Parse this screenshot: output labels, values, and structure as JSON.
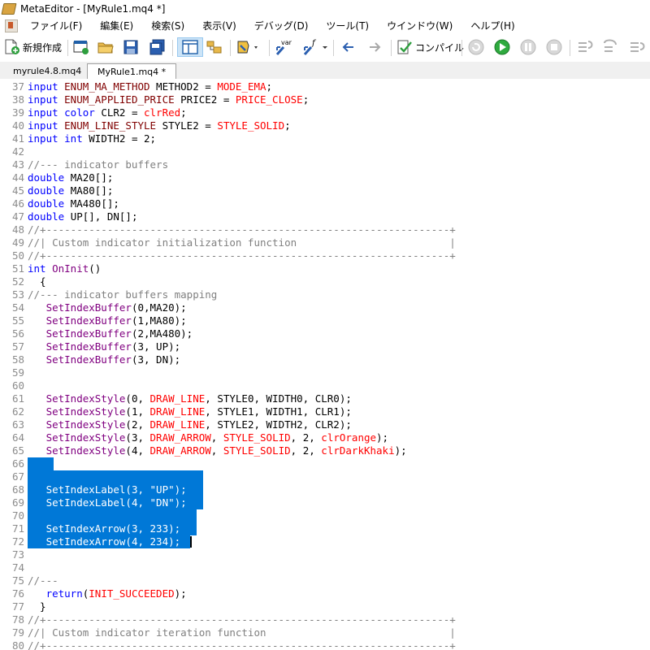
{
  "window": {
    "title": "MetaEditor - [MyRule1.mq4 *]"
  },
  "menu": [
    "ファイル(F)",
    "編集(E)",
    "検索(S)",
    "表示(V)",
    "デバッグ(D)",
    "ツール(T)",
    "ウインドウ(W)",
    "ヘルプ(H)"
  ],
  "toolbar": {
    "new_label": "新規作成",
    "compile_label": "コンパイル",
    "var_label": "var",
    "f_label": "f"
  },
  "tabs": [
    {
      "label": "myrule4.8.mq4",
      "active": false
    },
    {
      "label": "MyRule1.mq4 *",
      "active": true
    }
  ],
  "colors": {
    "selection": "#0078d7",
    "keyword": "#0000ff",
    "constant": "#ff0000",
    "function": "#800080",
    "comment": "#808080"
  },
  "selection": {
    "from_line": 66,
    "to_line": 72
  },
  "lines": [
    {
      "n": "37",
      "tokens": [
        [
          "kw",
          "input "
        ],
        [
          "ty",
          "ENUM_MA_METHOD"
        ],
        [
          "id",
          " METHOD2 = "
        ],
        [
          "cn",
          "MODE_EMA"
        ],
        [
          "id",
          ";"
        ]
      ]
    },
    {
      "n": "38",
      "tokens": [
        [
          "kw",
          "input "
        ],
        [
          "ty",
          "ENUM_APPLIED_PRICE"
        ],
        [
          "id",
          " PRICE2 = "
        ],
        [
          "cn",
          "PRICE_CLOSE"
        ],
        [
          "id",
          ";"
        ]
      ]
    },
    {
      "n": "39",
      "tokens": [
        [
          "kw",
          "input color "
        ],
        [
          "id",
          "CLR2 = "
        ],
        [
          "cn",
          "clrRed"
        ],
        [
          "id",
          ";"
        ]
      ]
    },
    {
      "n": "40",
      "tokens": [
        [
          "kw",
          "input "
        ],
        [
          "ty",
          "ENUM_LINE_STYLE"
        ],
        [
          "id",
          " STYLE2 = "
        ],
        [
          "cn",
          "STYLE_SOLID"
        ],
        [
          "id",
          ";"
        ]
      ]
    },
    {
      "n": "41",
      "tokens": [
        [
          "kw",
          "input int "
        ],
        [
          "id",
          "WIDTH2 = 2;"
        ]
      ]
    },
    {
      "n": "42",
      "tokens": []
    },
    {
      "n": "43",
      "tokens": [
        [
          "cm",
          "//--- indicator buffers"
        ]
      ]
    },
    {
      "n": "44",
      "tokens": [
        [
          "kw",
          "double "
        ],
        [
          "id",
          "MA20[];"
        ]
      ]
    },
    {
      "n": "45",
      "tokens": [
        [
          "kw",
          "double "
        ],
        [
          "id",
          "MA80[];"
        ]
      ]
    },
    {
      "n": "46",
      "tokens": [
        [
          "kw",
          "double "
        ],
        [
          "id",
          "MA480[];"
        ]
      ]
    },
    {
      "n": "47",
      "tokens": [
        [
          "kw",
          "double "
        ],
        [
          "id",
          "UP[], DN[];"
        ]
      ]
    },
    {
      "n": "48",
      "tokens": [
        [
          "cm",
          "//+------------------------------------------------------------------+"
        ]
      ]
    },
    {
      "n": "49",
      "tokens": [
        [
          "cm",
          "//| Custom indicator initialization function                         |"
        ]
      ]
    },
    {
      "n": "50",
      "tokens": [
        [
          "cm",
          "//+------------------------------------------------------------------+"
        ]
      ]
    },
    {
      "n": "51",
      "tokens": [
        [
          "kw",
          "int "
        ],
        [
          "fn",
          "OnInit"
        ],
        [
          "id",
          "()"
        ]
      ]
    },
    {
      "n": "52",
      "tokens": [
        [
          "id",
          "  {"
        ]
      ]
    },
    {
      "n": "53",
      "tokens": [
        [
          "cm",
          "//--- indicator buffers mapping"
        ]
      ]
    },
    {
      "n": "54",
      "tokens": [
        [
          "fn",
          "   SetIndexBuffer"
        ],
        [
          "id",
          "(0,MA20);"
        ]
      ]
    },
    {
      "n": "55",
      "tokens": [
        [
          "fn",
          "   SetIndexBuffer"
        ],
        [
          "id",
          "(1,MA80);"
        ]
      ]
    },
    {
      "n": "56",
      "tokens": [
        [
          "fn",
          "   SetIndexBuffer"
        ],
        [
          "id",
          "(2,MA480);"
        ]
      ]
    },
    {
      "n": "57",
      "tokens": [
        [
          "fn",
          "   SetIndexBuffer"
        ],
        [
          "id",
          "(3, UP);"
        ]
      ]
    },
    {
      "n": "58",
      "tokens": [
        [
          "fn",
          "   SetIndexBuffer"
        ],
        [
          "id",
          "(3, DN);"
        ]
      ]
    },
    {
      "n": "59",
      "tokens": []
    },
    {
      "n": "60",
      "tokens": []
    },
    {
      "n": "61",
      "tokens": [
        [
          "fn",
          "   SetIndexStyle"
        ],
        [
          "id",
          "(0, "
        ],
        [
          "cn",
          "DRAW_LINE"
        ],
        [
          "id",
          ", STYLE0, WIDTH0, CLR0);"
        ]
      ]
    },
    {
      "n": "62",
      "tokens": [
        [
          "fn",
          "   SetIndexStyle"
        ],
        [
          "id",
          "(1, "
        ],
        [
          "cn",
          "DRAW_LINE"
        ],
        [
          "id",
          ", STYLE1, WIDTH1, CLR1);"
        ]
      ]
    },
    {
      "n": "63",
      "tokens": [
        [
          "fn",
          "   SetIndexStyle"
        ],
        [
          "id",
          "(2, "
        ],
        [
          "cn",
          "DRAW_LINE"
        ],
        [
          "id",
          ", STYLE2, WIDTH2, CLR2);"
        ]
      ]
    },
    {
      "n": "64",
      "tokens": [
        [
          "fn",
          "   SetIndexStyle"
        ],
        [
          "id",
          "(3, "
        ],
        [
          "cn",
          "DRAW_ARROW"
        ],
        [
          "id",
          ", "
        ],
        [
          "cn",
          "STYLE_SOLID"
        ],
        [
          "id",
          ", 2, "
        ],
        [
          "cn",
          "clrOrange"
        ],
        [
          "id",
          ");"
        ]
      ]
    },
    {
      "n": "65",
      "tokens": [
        [
          "fn",
          "   SetIndexStyle"
        ],
        [
          "id",
          "(4, "
        ],
        [
          "cn",
          "DRAW_ARROW"
        ],
        [
          "id",
          ", "
        ],
        [
          "cn",
          "STYLE_SOLID"
        ],
        [
          "id",
          ", 2, "
        ],
        [
          "cn",
          "clrDarkKhaki"
        ],
        [
          "id",
          ");"
        ]
      ]
    },
    {
      "n": "66",
      "tokens": []
    },
    {
      "n": "67",
      "tokens": []
    },
    {
      "n": "68",
      "tokens": [
        [
          "fn",
          "   SetIndexLabel"
        ],
        [
          "id",
          "(3, \"UP\");"
        ]
      ]
    },
    {
      "n": "69",
      "tokens": [
        [
          "fn",
          "   SetIndexLabel"
        ],
        [
          "id",
          "(4, \"DN\");"
        ]
      ]
    },
    {
      "n": "70",
      "tokens": []
    },
    {
      "n": "71",
      "tokens": [
        [
          "fn",
          "   SetIndexArrow"
        ],
        [
          "id",
          "(3, 233);"
        ]
      ]
    },
    {
      "n": "72",
      "tokens": [
        [
          "fn",
          "   SetIndexArrow"
        ],
        [
          "id",
          "(4, 234);"
        ]
      ]
    },
    {
      "n": "73",
      "tokens": []
    },
    {
      "n": "74",
      "tokens": []
    },
    {
      "n": "75",
      "tokens": [
        [
          "cm",
          "//---"
        ]
      ]
    },
    {
      "n": "76",
      "tokens": [
        [
          "kw",
          "   return"
        ],
        [
          "id",
          "("
        ],
        [
          "cn",
          "INIT_SUCCEEDED"
        ],
        [
          "id",
          ");"
        ]
      ]
    },
    {
      "n": "77",
      "tokens": [
        [
          "id",
          "  }"
        ]
      ]
    },
    {
      "n": "78",
      "tokens": [
        [
          "cm",
          "//+------------------------------------------------------------------+"
        ]
      ]
    },
    {
      "n": "79",
      "tokens": [
        [
          "cm",
          "//| Custom indicator iteration function                              |"
        ]
      ]
    },
    {
      "n": "80",
      "tokens": [
        [
          "cm",
          "//+------------------------------------------------------------------+"
        ]
      ]
    }
  ]
}
